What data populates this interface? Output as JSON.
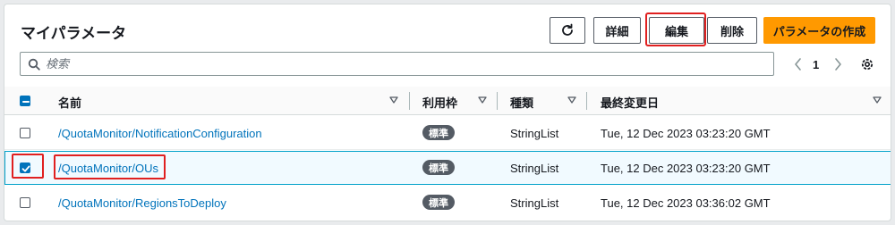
{
  "panel": {
    "title": "マイパラメータ"
  },
  "toolbar": {
    "refresh_icon": "refresh-icon",
    "details_label": "詳細",
    "edit_label": "編集",
    "delete_label": "削除",
    "create_label": "パラメータの作成"
  },
  "search": {
    "placeholder": "検索",
    "icon": "search-icon"
  },
  "pagination": {
    "current_page": "1",
    "prev_icon": "chevron-left-icon",
    "next_icon": "chevron-right-icon",
    "settings_icon": "gear-icon"
  },
  "table": {
    "columns": [
      "名前",
      "利用枠",
      "種類",
      "最終変更日"
    ],
    "rows": [
      {
        "name": "/QuotaMonitor/NotificationConfiguration",
        "tier": "標準",
        "type": "StringList",
        "last_modified": "Tue, 12 Dec 2023 03:23:20 GMT",
        "selected": false
      },
      {
        "name": "/QuotaMonitor/OUs",
        "tier": "標準",
        "type": "StringList",
        "last_modified": "Tue, 12 Dec 2023 03:23:20 GMT",
        "selected": true
      },
      {
        "name": "/QuotaMonitor/RegionsToDeploy",
        "tier": "標準",
        "type": "StringList",
        "last_modified": "Tue, 12 Dec 2023 03:36:02 GMT",
        "selected": false
      }
    ]
  },
  "colors": {
    "primary_button": "#ff9900",
    "link": "#0073bb",
    "highlight_outline": "#e02020",
    "selected_row": "#f1faff",
    "badge": "#545b64"
  }
}
